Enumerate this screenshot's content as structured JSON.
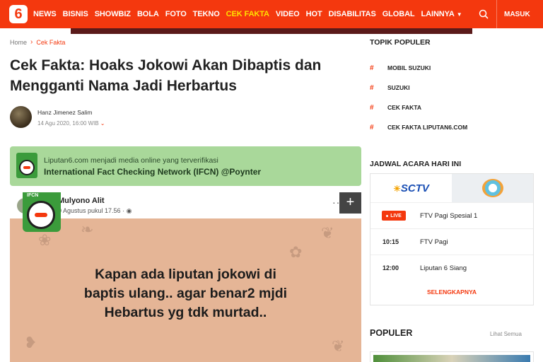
{
  "nav": {
    "logo": "6",
    "items": [
      "NEWS",
      "BISNIS",
      "SHOWBIZ",
      "BOLA",
      "FOTO",
      "TEKNO",
      "CEK FAKTA",
      "VIDEO",
      "HOT",
      "DISABILITAS",
      "GLOBAL",
      "LAINNYA"
    ],
    "active_item": "CEK FAKTA",
    "login_label": "MASUK",
    "accent_color": "#f4380e",
    "active_color": "#ffe000"
  },
  "breadcrumb": {
    "home": "Home",
    "current": "Cek Fakta"
  },
  "article": {
    "title": "Cek Fakta: Hoaks Jokowi Akan Dibaptis dan Mengganti Nama Jadi Herbartus",
    "author": "Hanz Jimenez Salim",
    "date": "14 Agu 2020, 16:00 WIB"
  },
  "ifcn_banner": {
    "line1": "Liputan6.com menjadi media online yang terverifikasi",
    "line2": "International Fact Checking Network (IFCN) @Poynter",
    "background": "#a9d89a"
  },
  "post": {
    "user": "Mulyono Alit",
    "time": "0 Agustus pukul 17.56 · ",
    "text_line1": "Kapan ada liputan jokowi di",
    "text_line2": "baptis ulang.. agar benar2 mjdi",
    "text_line3": "Hebartus yg tdk murtad..",
    "sticker_label": "IFCN",
    "menu_dots": "···",
    "expand_label": "+"
  },
  "sidebar": {
    "topik_heading": "TOPIK POPULER",
    "topik_items": [
      "MOBIL SUZUKI",
      "SUZUKI",
      "CEK FAKTA",
      "CEK FAKTA LIPUTAN6.COM"
    ],
    "hash_symbol": "#",
    "jadwal_heading": "JADWAL ACARA HARI INI",
    "channels": [
      "SCTV",
      "Indosiar"
    ],
    "schedule": [
      {
        "time": "LIVE",
        "title": "FTV Pagi Spesial 1"
      },
      {
        "time": "10:15",
        "title": "FTV Pagi"
      },
      {
        "time": "12:00",
        "title": "Liputan 6 Siang"
      }
    ],
    "more_label": "SELENGKAPNYA",
    "populer_heading": "POPULER",
    "populer_all": "Lihat Semua"
  },
  "icons": [
    "search-icon",
    "chevron-right-icon",
    "chevron-down-icon",
    "globe-icon",
    "live-dot-icon"
  ]
}
